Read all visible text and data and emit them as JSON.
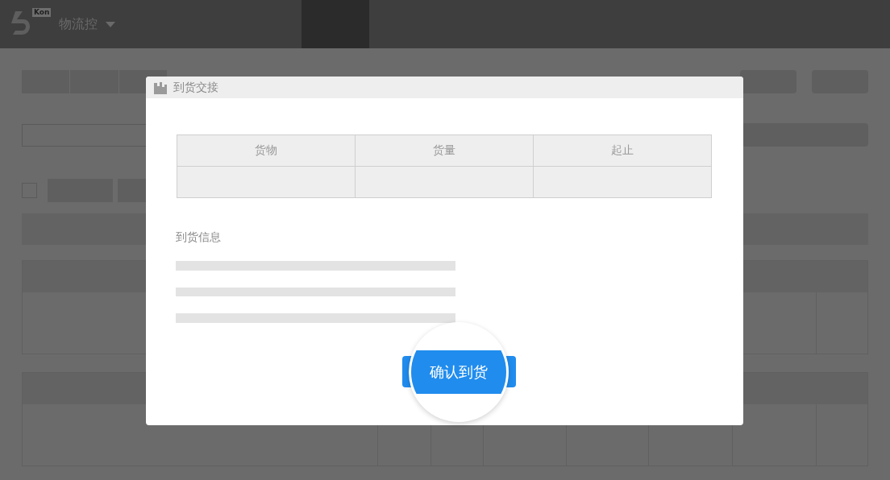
{
  "header": {
    "logo_badge": "Kon",
    "title": "物流控"
  },
  "dialog": {
    "title": "到货交接",
    "table": {
      "columns": [
        "货物",
        "货量",
        "起止"
      ]
    },
    "section_label": "到货信息",
    "button": "确认到货"
  }
}
